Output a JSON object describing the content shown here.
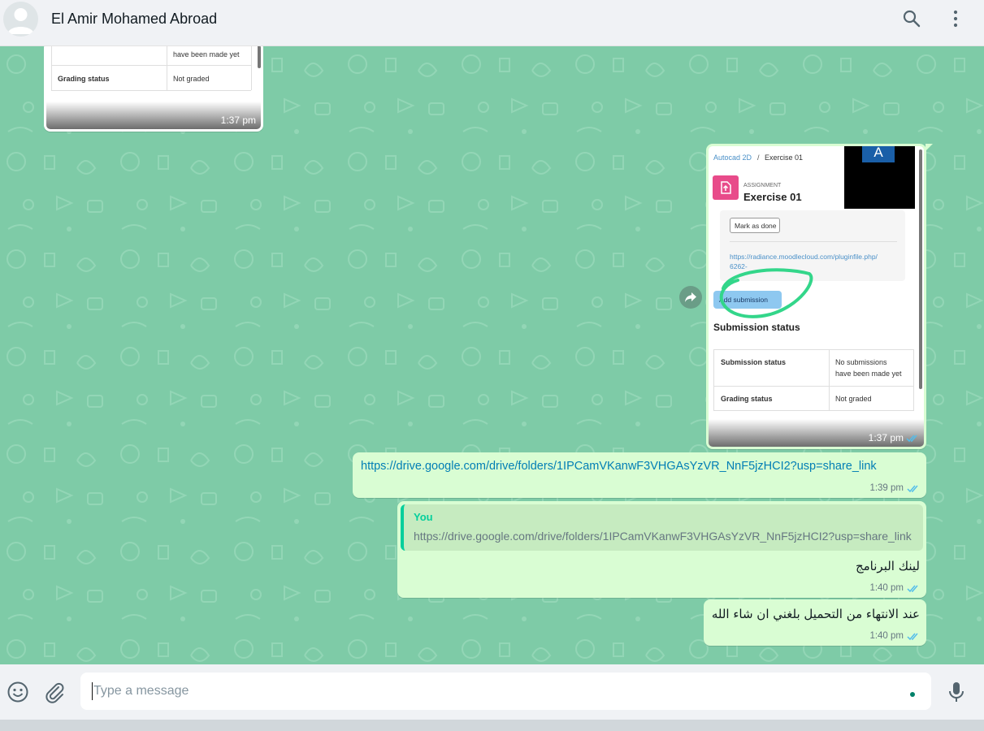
{
  "header": {
    "contact_name": "El Amir Mohamed Abroad",
    "icons": [
      "search-icon",
      "menu-icon"
    ]
  },
  "messages": {
    "image1": {
      "time": "1:37 pm",
      "rows": [
        {
          "label": "",
          "value": "have been made yet"
        },
        {
          "label": "Grading status",
          "value": "Not graded"
        }
      ]
    },
    "image2": {
      "time": "1:37 pm",
      "breadcrumb_link": "Autocad 2D",
      "breadcrumb_sep": "/",
      "breadcrumb_current": "Exercise 01",
      "assignment_kind": "ASSIGNMENT",
      "assignment_title": "Exercise 01",
      "avatar_letter": "A",
      "mark_done": "Mark as done",
      "file_link": "https://radiance.moodlecloud.com/pluginfile.php/",
      "file_link2": "6262-",
      "add_submission": "Add submission",
      "section_title": "Submission status",
      "rows": [
        {
          "label": "Submission status",
          "value1": "No submissions",
          "value2": "have been made yet"
        },
        {
          "label": "Grading status",
          "value1": "Not graded",
          "value2": ""
        }
      ]
    },
    "link_msg": {
      "text": "https://drive.google.com/drive/folders/1IPCamVKanwF3VHGAsYzVR_NnF5jzHCI2?usp=share_link",
      "time": "1:39 pm"
    },
    "reply_msg": {
      "quote_author": "You",
      "quote_text": "https://drive.google.com/drive/folders/1IPCamVKanwF3VHGAsYzVR_NnF5jzHCI2?usp=share_link",
      "text": "لينك البرنامج",
      "time": "1:40 pm"
    },
    "last_msg": {
      "text": "عند الانتهاء من التحميل بلغني ان شاء الله",
      "time": "1:40 pm"
    }
  },
  "composer": {
    "placeholder": "Type a message",
    "icons": [
      "emoji-icon",
      "attach-icon",
      "microphone-icon"
    ]
  },
  "colors": {
    "wallpaper": "#7ecba7",
    "outgoing_bubble": "#d9fdd3",
    "link": "#027eb5",
    "read_ticks": "#53bdeb",
    "accent": "#06cf9c"
  }
}
